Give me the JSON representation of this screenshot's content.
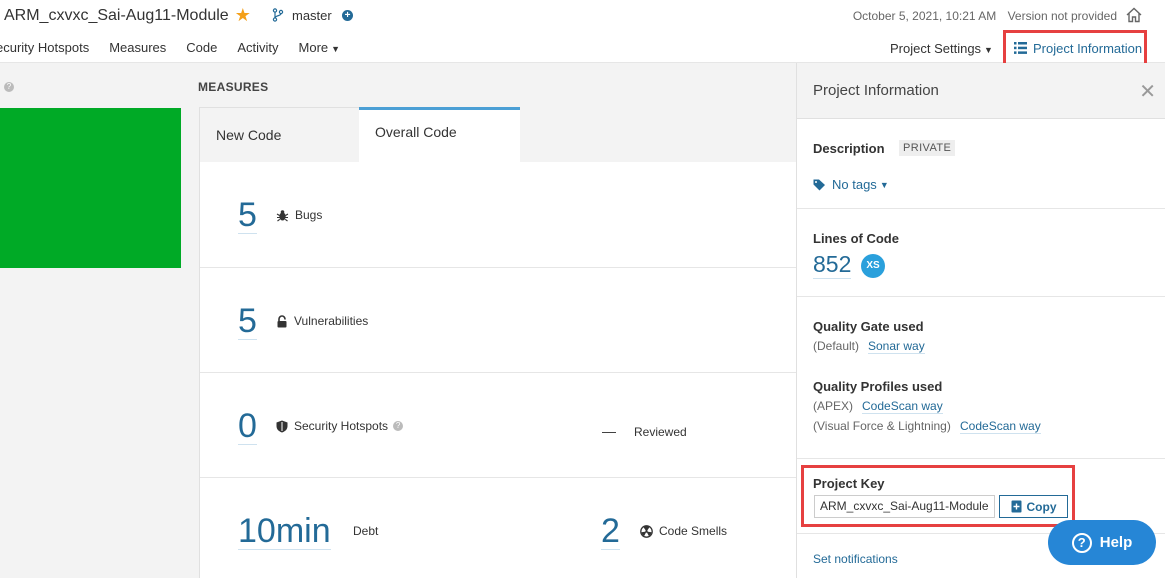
{
  "header": {
    "project_name": "ARM_cxvxc_Sai-Aug11-Module",
    "branch": "master",
    "date": "October 5, 2021, 10:21 AM",
    "version": "Version not provided",
    "project_settings": "Project Settings",
    "project_information": "Project Information"
  },
  "nav": {
    "items": [
      "ecurity Hotspots",
      "Measures",
      "Code",
      "Activity",
      "More"
    ]
  },
  "measures": {
    "section_label": "MEASURES",
    "tabs": [
      "New Code",
      "Overall Code"
    ],
    "bugs": {
      "value": "5",
      "label": "Bugs"
    },
    "vulnerabilities": {
      "value": "5",
      "label": "Vulnerabilities"
    },
    "hotspots": {
      "value": "0",
      "label": "Security Hotspots",
      "reviewed_value": "—",
      "reviewed_label": "Reviewed"
    },
    "debt": {
      "value": "10min",
      "label": "Debt"
    },
    "code_smells": {
      "value": "2",
      "label": "Code Smells"
    }
  },
  "sidebar": {
    "title": "Project Information",
    "description_label": "Description",
    "visibility": "PRIVATE",
    "tags": "No tags",
    "loc_label": "Lines of Code",
    "loc_value": "852",
    "size_badge": "XS",
    "quality_gate_label": "Quality Gate used",
    "quality_gate_default": "(Default)",
    "quality_gate_name": "Sonar way",
    "quality_profiles_label": "Quality Profiles used",
    "profile_1_lang": "(APEX)",
    "profile_1_name": "CodeScan way",
    "profile_2_lang": "(Visual Force & Lightning)",
    "profile_2_name": "CodeScan way",
    "project_key_label": "Project Key",
    "project_key_value": "ARM_cxvxc_Sai-Aug11-Module",
    "copy_label": "Copy",
    "notifications": "Set notifications"
  },
  "help": {
    "label": "Help"
  },
  "colors": {
    "accent": "#236a97",
    "quality_gate_passed": "#00aa26",
    "highlight": "#e64040",
    "help_button": "#2686d6"
  }
}
